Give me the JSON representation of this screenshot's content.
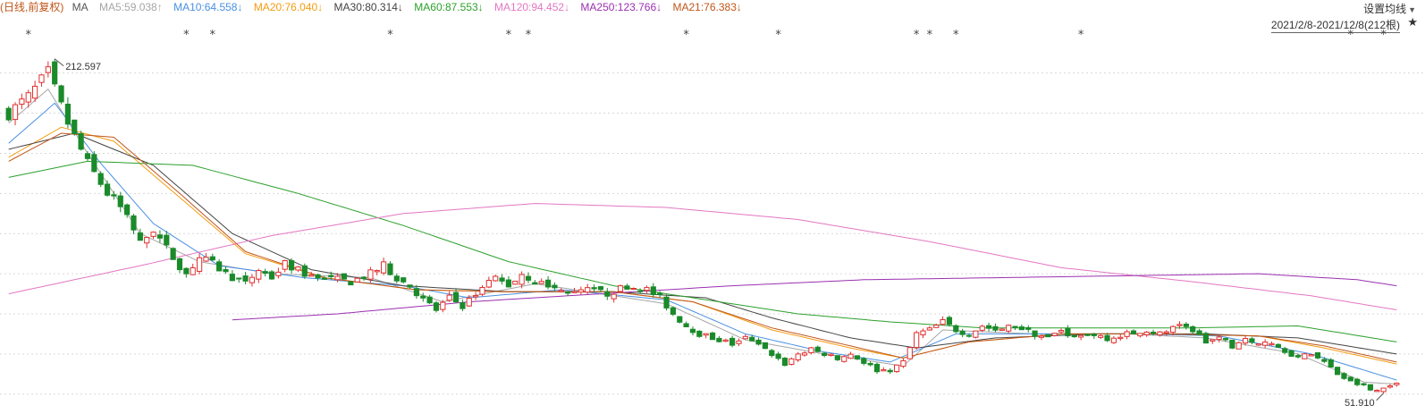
{
  "legend": {
    "title": "(日线,前复权)",
    "ma_label": "MA",
    "items": [
      {
        "text": "MA5:59.038↑",
        "color": "#a6a6a6"
      },
      {
        "text": "MA10:64.558↓",
        "color": "#4a90e2"
      },
      {
        "text": "MA20:76.040↓",
        "color": "#f39c12"
      },
      {
        "text": "MA30:80.314↓",
        "color": "#444444"
      },
      {
        "text": "MA60:87.553↓",
        "color": "#2ca02c"
      },
      {
        "text": "MA120:94.452↓",
        "color": "#e377c2"
      },
      {
        "text": "MA250:123.766↓",
        "color": "#9b30b0"
      },
      {
        "text": "MA21:76.383↓",
        "color": "#c0561a"
      }
    ]
  },
  "settings_label": "设置均线",
  "date_range": "2021/2/8-2021/12/8(212根)",
  "colors": {
    "up": "#e03030",
    "down": "#1a8a2a",
    "grid": "#d8d8d8"
  },
  "chart_data": {
    "type": "candlestick",
    "period": "日线",
    "adjustment": "前复权",
    "date_range": [
      "2021/2/8",
      "2021/12/8"
    ],
    "bar_count": 212,
    "max_price": 212.597,
    "min_price": 51.91,
    "ylim": [
      45,
      225
    ],
    "grid": true,
    "close_path": [
      [
        0,
        190
      ],
      [
        3,
        198
      ],
      [
        6,
        210
      ],
      [
        9,
        185
      ],
      [
        12,
        165
      ],
      [
        15,
        150
      ],
      [
        18,
        140
      ],
      [
        20,
        125
      ],
      [
        22,
        132
      ],
      [
        25,
        118
      ],
      [
        27,
        110
      ],
      [
        29,
        118
      ],
      [
        31,
        115
      ],
      [
        33,
        110
      ],
      [
        36,
        105
      ],
      [
        38,
        112
      ],
      [
        40,
        108
      ],
      [
        42,
        115
      ],
      [
        45,
        110
      ],
      [
        48,
        108
      ],
      [
        52,
        106
      ],
      [
        55,
        110
      ],
      [
        57,
        114
      ],
      [
        59,
        108
      ],
      [
        61,
        104
      ],
      [
        63,
        97
      ],
      [
        65,
        92
      ],
      [
        67,
        98
      ],
      [
        69,
        94
      ],
      [
        71,
        100
      ],
      [
        74,
        108
      ],
      [
        76,
        104
      ],
      [
        78,
        110
      ],
      [
        80,
        106
      ],
      [
        82,
        104
      ],
      [
        85,
        100
      ],
      [
        88,
        102
      ],
      [
        91,
        100
      ],
      [
        94,
        104
      ],
      [
        97,
        102
      ],
      [
        99,
        98
      ],
      [
        101,
        90
      ],
      [
        103,
        84
      ],
      [
        105,
        80
      ],
      [
        107,
        78
      ],
      [
        110,
        75
      ],
      [
        112,
        78
      ],
      [
        114,
        74
      ],
      [
        116,
        70
      ],
      [
        118,
        65
      ],
      [
        120,
        70
      ],
      [
        122,
        72
      ],
      [
        124,
        70
      ],
      [
        126,
        68
      ],
      [
        128,
        70
      ],
      [
        130,
        66
      ],
      [
        132,
        62
      ],
      [
        134,
        62
      ],
      [
        136,
        66
      ],
      [
        138,
        80
      ],
      [
        140,
        82
      ],
      [
        142,
        86
      ],
      [
        144,
        82
      ],
      [
        146,
        80
      ],
      [
        148,
        84
      ],
      [
        150,
        82
      ],
      [
        153,
        84
      ],
      [
        156,
        80
      ],
      [
        158,
        78
      ],
      [
        160,
        82
      ],
      [
        162,
        78
      ],
      [
        165,
        80
      ],
      [
        167,
        78
      ],
      [
        170,
        80
      ],
      [
        173,
        82
      ],
      [
        175,
        80
      ],
      [
        178,
        84
      ],
      [
        180,
        82
      ],
      [
        182,
        76
      ],
      [
        184,
        78
      ],
      [
        186,
        74
      ],
      [
        188,
        78
      ],
      [
        190,
        76
      ],
      [
        192,
        75
      ],
      [
        194,
        72
      ],
      [
        196,
        68
      ],
      [
        198,
        70
      ],
      [
        200,
        66
      ],
      [
        202,
        60
      ],
      [
        204,
        56
      ],
      [
        206,
        54
      ],
      [
        208,
        51.91
      ],
      [
        210,
        54
      ],
      [
        211,
        55
      ]
    ],
    "markers": [
      3,
      27,
      31,
      58,
      76,
      79,
      103,
      117,
      138,
      140,
      144,
      163,
      204,
      209
    ],
    "moving_averages": [
      {
        "name": "MA5",
        "value": 59.038,
        "trend": "up",
        "color": "#a6a6a6",
        "points": [
          [
            0,
            185
          ],
          [
            6,
            202
          ],
          [
            12,
            170
          ],
          [
            20,
            130
          ],
          [
            29,
            116
          ],
          [
            40,
            110
          ],
          [
            55,
            108
          ],
          [
            66,
            96
          ],
          [
            80,
            105
          ],
          [
            100,
            95
          ],
          [
            112,
            77
          ],
          [
            124,
            70
          ],
          [
            136,
            64
          ],
          [
            142,
            82
          ],
          [
            156,
            80
          ],
          [
            170,
            80
          ],
          [
            182,
            78
          ],
          [
            196,
            70
          ],
          [
            206,
            56
          ],
          [
            211,
            55
          ]
        ]
      },
      {
        "name": "MA10",
        "value": 64.558,
        "trend": "down",
        "color": "#4a90e2",
        "points": [
          [
            0,
            175
          ],
          [
            7,
            195
          ],
          [
            14,
            165
          ],
          [
            22,
            135
          ],
          [
            32,
            114
          ],
          [
            45,
            108
          ],
          [
            60,
            104
          ],
          [
            70,
            98
          ],
          [
            84,
            102
          ],
          [
            100,
            97
          ],
          [
            112,
            80
          ],
          [
            124,
            71
          ],
          [
            134,
            66
          ],
          [
            144,
            80
          ],
          [
            158,
            80
          ],
          [
            172,
            80
          ],
          [
            184,
            79
          ],
          [
            198,
            70
          ],
          [
            206,
            62
          ],
          [
            211,
            57
          ]
        ]
      },
      {
        "name": "MA20",
        "value": 76.04,
        "trend": "down",
        "color": "#f39c12",
        "points": [
          [
            0,
            168
          ],
          [
            8,
            183
          ],
          [
            16,
            176
          ],
          [
            26,
            148
          ],
          [
            36,
            120
          ],
          [
            48,
            108
          ],
          [
            62,
            102
          ],
          [
            76,
            101
          ],
          [
            92,
            101
          ],
          [
            104,
            96
          ],
          [
            116,
            82
          ],
          [
            128,
            73
          ],
          [
            136,
            68
          ],
          [
            146,
            76
          ],
          [
            160,
            80
          ],
          [
            176,
            80
          ],
          [
            190,
            79
          ],
          [
            200,
            73
          ],
          [
            211,
            65
          ]
        ]
      },
      {
        "name": "MA30",
        "value": 80.314,
        "trend": "down",
        "color": "#444444",
        "points": [
          [
            0,
            172
          ],
          [
            10,
            180
          ],
          [
            22,
            164
          ],
          [
            34,
            130
          ],
          [
            46,
            112
          ],
          [
            60,
            104
          ],
          [
            76,
            101
          ],
          [
            92,
            101
          ],
          [
            106,
            98
          ],
          [
            116,
            88
          ],
          [
            128,
            78
          ],
          [
            138,
            73
          ],
          [
            150,
            78
          ],
          [
            166,
            80
          ],
          [
            182,
            80
          ],
          [
            196,
            78
          ],
          [
            211,
            70
          ]
        ]
      },
      {
        "name": "MA60",
        "value": 87.553,
        "trend": "down",
        "color": "#2ca02c",
        "points": [
          [
            0,
            158
          ],
          [
            12,
            166
          ],
          [
            28,
            164
          ],
          [
            44,
            150
          ],
          [
            60,
            134
          ],
          [
            76,
            116
          ],
          [
            92,
            104
          ],
          [
            106,
            97
          ],
          [
            120,
            90
          ],
          [
            134,
            86
          ],
          [
            148,
            83
          ],
          [
            164,
            83
          ],
          [
            180,
            83
          ],
          [
            196,
            84
          ],
          [
            211,
            76
          ]
        ]
      },
      {
        "name": "MA120",
        "value": 94.452,
        "trend": "down",
        "color": "#e377c2",
        "points": [
          [
            0,
            100
          ],
          [
            20,
            114
          ],
          [
            40,
            129
          ],
          [
            60,
            140
          ],
          [
            80,
            145
          ],
          [
            100,
            143
          ],
          [
            120,
            137
          ],
          [
            140,
            126
          ],
          [
            160,
            113
          ],
          [
            180,
            106
          ],
          [
            198,
            99
          ],
          [
            211,
            92
          ]
        ]
      },
      {
        "name": "MA250",
        "value": 123.766,
        "trend": "down",
        "color": "#9b30b0",
        "points": [
          [
            34,
            87
          ],
          [
            50,
            90
          ],
          [
            70,
            96
          ],
          [
            90,
            100
          ],
          [
            110,
            104
          ],
          [
            130,
            107
          ],
          [
            150,
            108
          ],
          [
            170,
            109
          ],
          [
            190,
            110
          ],
          [
            205,
            107
          ],
          [
            211,
            104
          ]
        ]
      },
      {
        "name": "MA21",
        "value": 76.383,
        "trend": "down",
        "color": "#c0561a",
        "points": [
          [
            0,
            166
          ],
          [
            8,
            180
          ],
          [
            16,
            178
          ],
          [
            26,
            150
          ],
          [
            36,
            121
          ],
          [
            48,
            108
          ],
          [
            62,
            102
          ],
          [
            76,
            101
          ],
          [
            92,
            101
          ],
          [
            104,
            96
          ],
          [
            116,
            83
          ],
          [
            128,
            74
          ],
          [
            136,
            68
          ],
          [
            146,
            76
          ],
          [
            160,
            80
          ],
          [
            176,
            80
          ],
          [
            190,
            79
          ],
          [
            200,
            74
          ],
          [
            211,
            66
          ]
        ]
      }
    ]
  }
}
